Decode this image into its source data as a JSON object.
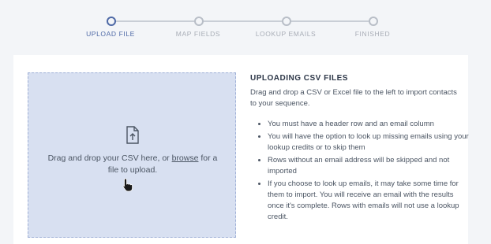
{
  "stepper": {
    "steps": [
      {
        "label": "UPLOAD FILE",
        "active": true
      },
      {
        "label": "MAP FIELDS",
        "active": false
      },
      {
        "label": "LOOKUP EMAILS",
        "active": false
      },
      {
        "label": "FINISHED",
        "active": false
      }
    ]
  },
  "dropzone": {
    "text_before": "Drag and drop your CSV here, or ",
    "browse_link": "browse",
    "text_after": " for a file to upload.",
    "icon": "file-upload-icon"
  },
  "info": {
    "title": "UPLOADING CSV FILES",
    "description": "Drag and drop a CSV or Excel file to the left to import contacts to your sequence.",
    "bullets": [
      "You must have a header row and an email column",
      "You will have the option to look up missing emails using your lookup credits or to skip them",
      "Rows without an email address will be skipped and not imported",
      "If you choose to look up emails, it may take some time for them to import. You will receive an email with the results once it's complete. Rows with emails will not use a lookup credit."
    ]
  },
  "colors": {
    "accent": "#4e69a6",
    "dropzone_bg": "#d8e0f1",
    "page_bg": "#f3f5f8"
  }
}
